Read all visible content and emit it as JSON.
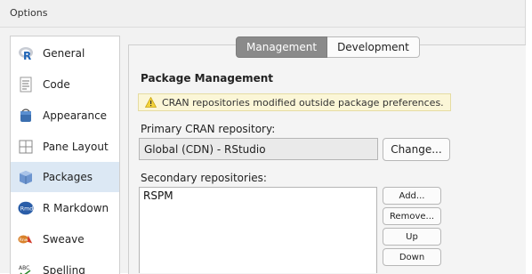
{
  "window": {
    "title": "Options"
  },
  "sidebar": {
    "items": [
      {
        "label": "General",
        "icon": "r-logo-icon",
        "active": false
      },
      {
        "label": "Code",
        "icon": "code-document-icon",
        "active": false
      },
      {
        "label": "Appearance",
        "icon": "paint-bucket-icon",
        "active": false
      },
      {
        "label": "Pane Layout",
        "icon": "pane-layout-icon",
        "active": false
      },
      {
        "label": "Packages",
        "icon": "package-box-icon",
        "active": true
      },
      {
        "label": "R Markdown",
        "icon": "rmd-icon",
        "active": false
      },
      {
        "label": "Sweave",
        "icon": "sweave-icon",
        "active": false
      },
      {
        "label": "Spelling",
        "icon": "spelling-abc-icon",
        "active": false
      }
    ]
  },
  "tabs": [
    {
      "label": "Management",
      "active": true
    },
    {
      "label": "Development",
      "active": false
    }
  ],
  "main": {
    "section_title": "Package Management",
    "warning_text": "CRAN repositories modified outside package preferences.",
    "primary_repo_label": "Primary CRAN repository:",
    "primary_repo_value": "Global (CDN) - RStudio",
    "change_button": "Change...",
    "secondary_label": "Secondary repositories:",
    "secondary_repos": [
      "RSPM"
    ],
    "buttons": {
      "add": "Add...",
      "remove": "Remove...",
      "up": "Up",
      "down": "Down"
    }
  },
  "colors": {
    "active_tab": "#8a8a8a",
    "sidebar_selection": "#dce8f4",
    "warning_bg": "#fbf6d7",
    "r_blue": "#1f65b7"
  }
}
